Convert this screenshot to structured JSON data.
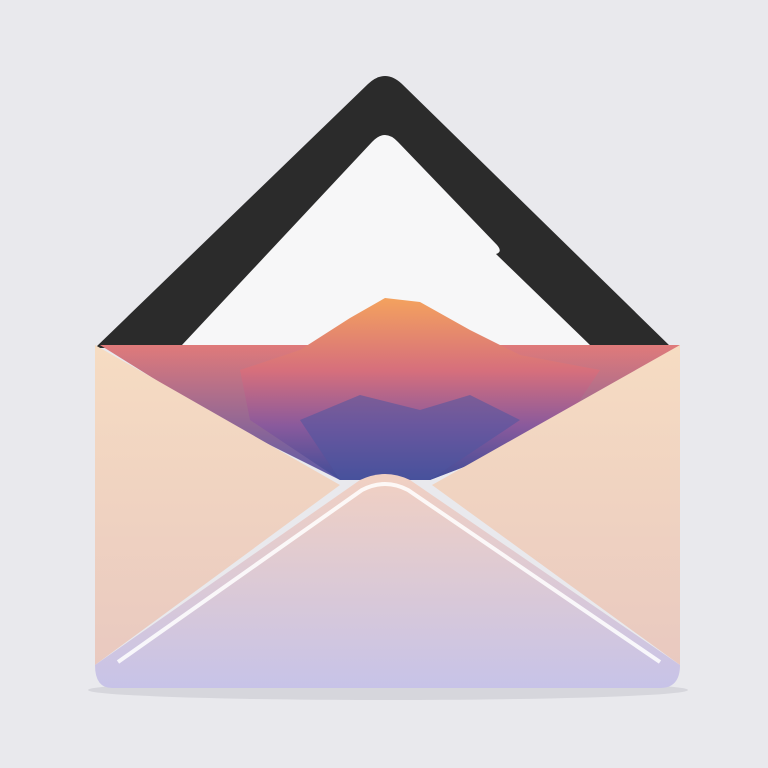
{
  "illustration": {
    "subject": "envelope-icon",
    "colors": {
      "background": "#e9e9ed",
      "back_flap": "#2b2b2b",
      "paper": "#f7f7f8",
      "mountain_peak": "#f4a25e",
      "mountain_mid": "#c0608a",
      "mountain_base": "#4f55a0",
      "side_flap": "#f5dcc4",
      "front_flap_top": "#f0cfc0",
      "front_flap_bottom": "#c9c3e6"
    }
  }
}
